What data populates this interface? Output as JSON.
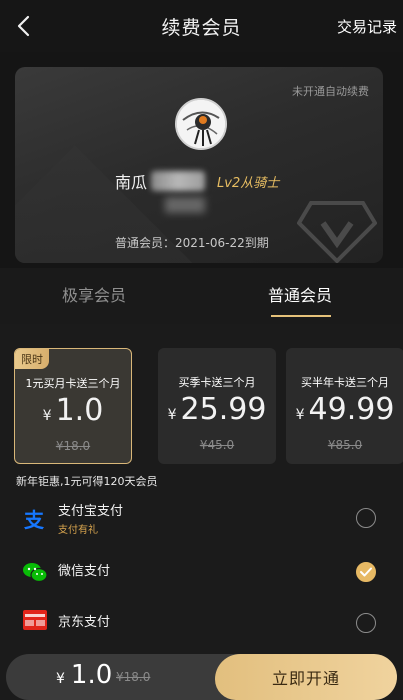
{
  "header": {
    "title": "续费会员",
    "transactions_label": "交易记录"
  },
  "card": {
    "auto_renew": "未开通自动续费",
    "username": "南瓜",
    "level": "Lv2从骑士",
    "expiry": "普通会员：2021-06-22到期"
  },
  "tabs": [
    {
      "label": "极享会员",
      "active": false
    },
    {
      "label": "普通会员",
      "active": true
    }
  ],
  "packages": [
    {
      "tag": "限时",
      "name": "1元买月卡送三个月",
      "currency": "¥",
      "price": "1.0",
      "original": "¥18.0",
      "selected": true
    },
    {
      "tag": "",
      "name": "买季卡送三个月",
      "currency": "¥",
      "price": "25.99",
      "original": "¥45.0",
      "selected": false
    },
    {
      "tag": "",
      "name": "买半年卡送三个月",
      "currency": "¥",
      "price": "49.99",
      "original": "¥85.0",
      "selected": false
    }
  ],
  "promo_text": "新年钜惠,1元可得120天会员",
  "payment": [
    {
      "name": "支付宝支付",
      "sub": "支付有礼",
      "icon": "alipay-icon",
      "selected": false
    },
    {
      "name": "微信支付",
      "sub": "",
      "icon": "wechat-pay-icon",
      "selected": true
    },
    {
      "name": "京东支付",
      "sub": "",
      "icon": "jd-pay-icon",
      "selected": false
    }
  ],
  "bottom": {
    "currency": "¥",
    "price": "1.0",
    "original": "¥18.0",
    "button_label": "立即开通"
  },
  "colors": {
    "accent_gold": "#e6c27a",
    "background": "#1b1b1b",
    "alipay_blue": "#1677ff",
    "wechat_green": "#09bb07",
    "jd_red": "#e1251b"
  }
}
